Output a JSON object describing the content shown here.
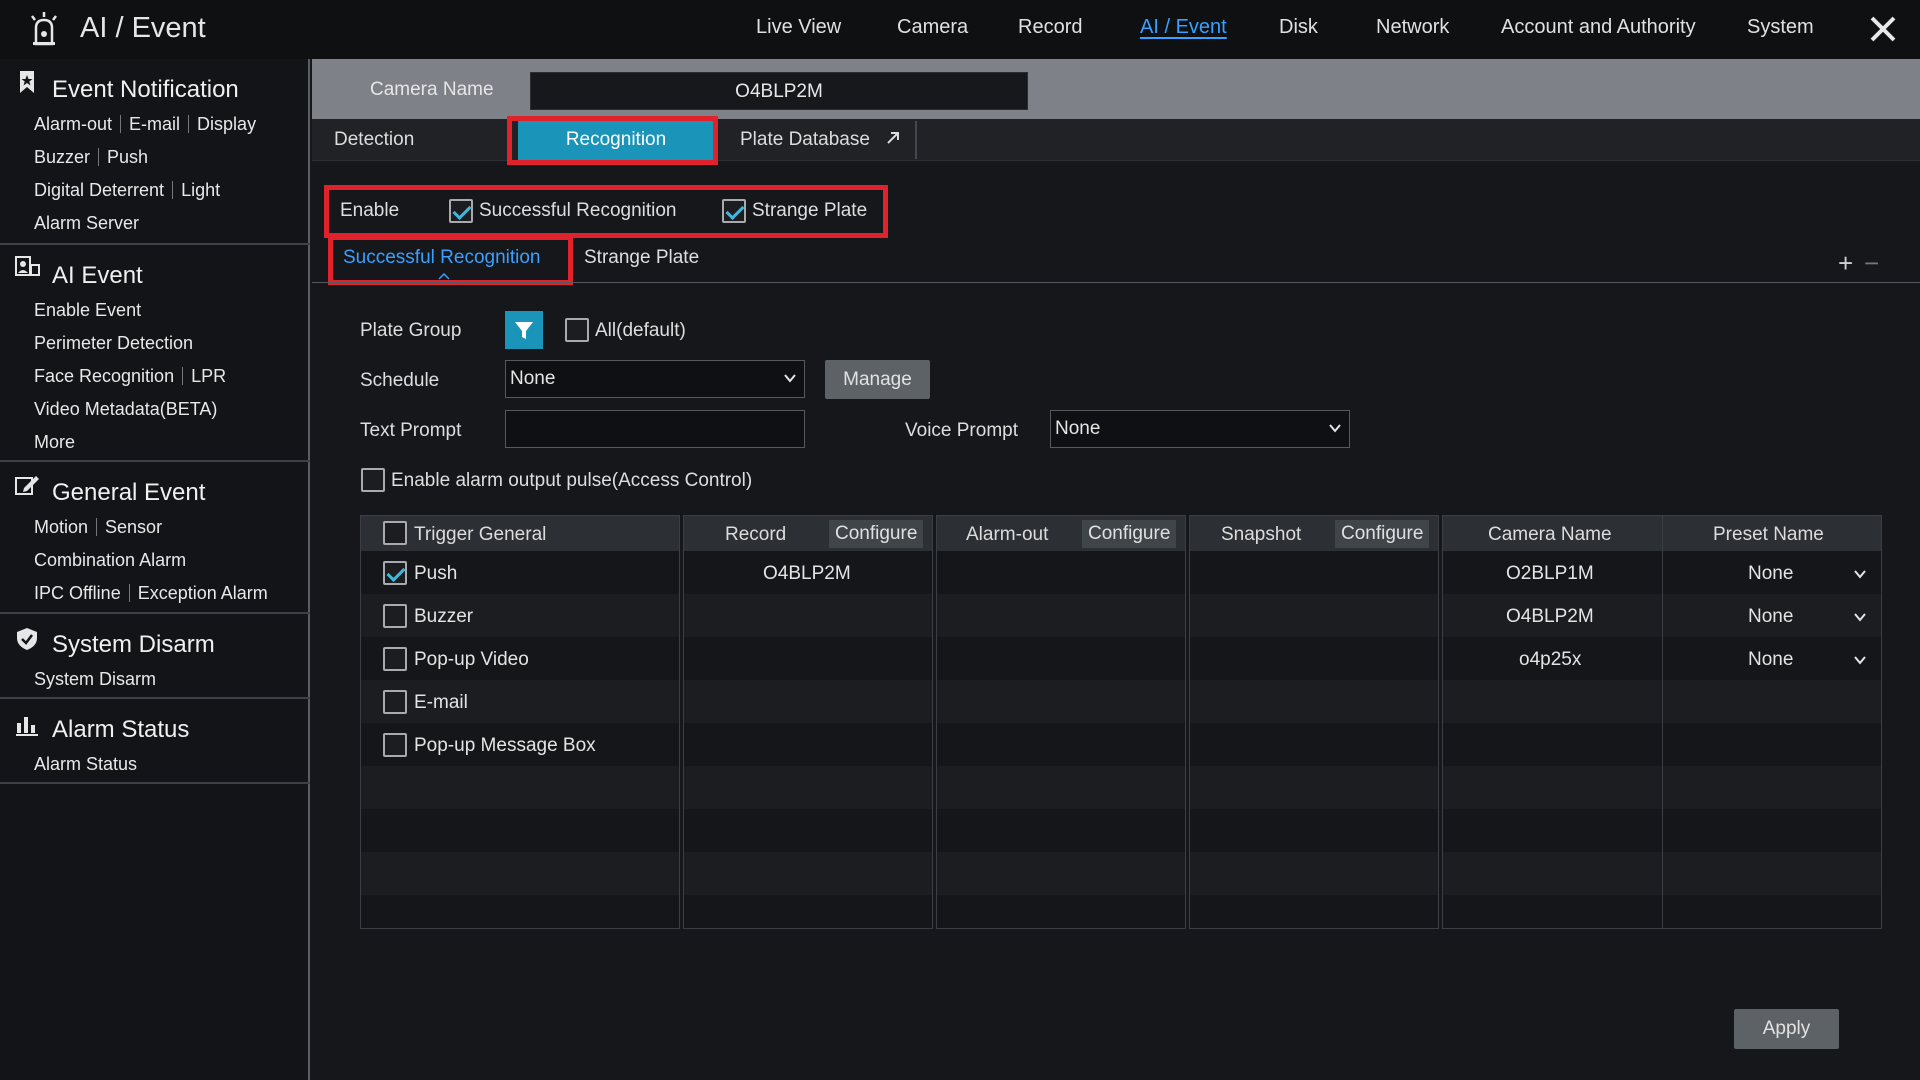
{
  "app": {
    "title": "AI / Event",
    "logo_icon": "alarm-bell-icon"
  },
  "nav": [
    "Live View",
    "Camera",
    "Record",
    "AI / Event",
    "Disk",
    "Network",
    "Account and Authority",
    "System"
  ],
  "nav_active": "AI / Event",
  "sidebar": {
    "event_notification": {
      "title": "Event Notification",
      "icon": "bookmark-star-icon",
      "items": [
        [
          "Alarm-out",
          "E-mail",
          "Display"
        ],
        [
          "Buzzer",
          "Push"
        ],
        [
          "Digital Deterrent",
          "Light"
        ],
        [
          "Alarm Server"
        ]
      ]
    },
    "ai_event": {
      "title": "AI Event",
      "icon": "ai-face-icon",
      "items": [
        [
          "Enable Event"
        ],
        [
          "Perimeter Detection"
        ],
        [
          "Face Recognition",
          "LPR"
        ],
        [
          "Video Metadata(BETA)"
        ],
        [
          "More"
        ]
      ]
    },
    "general_event": {
      "title": "General Event",
      "icon": "edit-event-icon",
      "items": [
        [
          "Motion",
          "Sensor"
        ],
        [
          "Combination Alarm"
        ],
        [
          "IPC Offline",
          "Exception Alarm"
        ]
      ]
    },
    "system_disarm": {
      "title": "System Disarm",
      "icon": "shield-icon",
      "items": [
        [
          "System Disarm"
        ]
      ]
    },
    "alarm_status": {
      "title": "Alarm Status",
      "icon": "bar-status-icon",
      "items": [
        [
          "Alarm Status"
        ]
      ]
    }
  },
  "camera": {
    "label": "Camera Name",
    "value": "O4BLP2M"
  },
  "tabs": {
    "detection": "Detection",
    "recognition": "Recognition",
    "plate_database": "Plate Database"
  },
  "enable": {
    "label": "Enable",
    "successful_recognition": "Successful Recognition",
    "strange_plate": "Strange Plate",
    "successful_checked": true,
    "strange_checked": true
  },
  "subtabs": {
    "successful": "Successful Recognition",
    "strange": "Strange Plate"
  },
  "form": {
    "plate_group_label": "Plate Group",
    "all_default": "All(default)",
    "schedule_label": "Schedule",
    "schedule_value": "None",
    "manage": "Manage",
    "text_prompt_label": "Text Prompt",
    "text_prompt_value": "",
    "voice_prompt_label": "Voice Prompt",
    "voice_prompt_value": "None",
    "alarm_pulse": "Enable alarm output pulse(Access Control)"
  },
  "table": {
    "trigger_header": "Trigger General",
    "triggers": [
      {
        "label": "Push",
        "checked": true
      },
      {
        "label": "Buzzer",
        "checked": false
      },
      {
        "label": "Pop-up Video",
        "checked": false
      },
      {
        "label": "E-mail",
        "checked": false
      },
      {
        "label": "Pop-up Message Box",
        "checked": false
      }
    ],
    "record_header": "Record",
    "record_values": [
      "O4BLP2M"
    ],
    "alarmout_header": "Alarm-out",
    "snapshot_header": "Snapshot",
    "configure": "Configure",
    "camera_header": "Camera Name",
    "preset_header": "Preset Name",
    "presets": [
      {
        "camera": "O2BLP1M",
        "preset": "None"
      },
      {
        "camera": "O4BLP2M",
        "preset": "None"
      },
      {
        "camera": "o4p25x",
        "preset": "None"
      }
    ]
  },
  "apply": "Apply",
  "colors": {
    "accent": "#1a94b8",
    "highlight": "#e0222c",
    "active_nav": "#3aa0ff"
  }
}
